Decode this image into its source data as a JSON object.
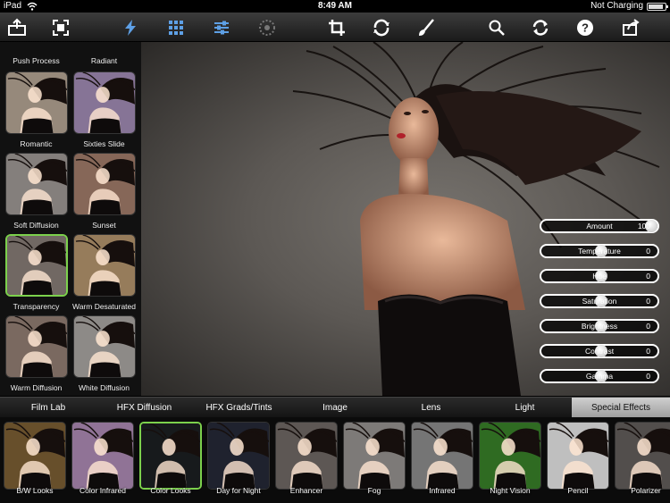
{
  "status": {
    "device": "iPad",
    "time": "8:49 AM",
    "charging": "Not Charging"
  },
  "toolbar": {
    "icons": [
      "import-icon",
      "fit-screen-icon",
      "presets-lightning-icon",
      "grid-icon",
      "adjust-sliders-icon",
      "mask-icon",
      "crop-icon",
      "rotate-icon",
      "brush-icon",
      "zoom-icon",
      "refresh-icon",
      "help-icon",
      "share-icon"
    ],
    "accent": "#5ea0e6"
  },
  "sidebar": {
    "top_labels": [
      "Push Process",
      "Radiant"
    ],
    "presets": [
      {
        "label": "Romantic",
        "tint": "#c9b7a4"
      },
      {
        "label": "Sixties Slide",
        "tint": "#b39bc8"
      },
      {
        "label": "Soft Diffusion",
        "tint": "#b0aaa6"
      },
      {
        "label": "Sunset",
        "tint": "#b38a76"
      },
      {
        "label": "Transparency",
        "tint": "#978b85"
      },
      {
        "label": "Warm Desaturated",
        "tint": "#c9a67a"
      },
      {
        "label": "Warm Diffusion",
        "tint": "#a38d80"
      },
      {
        "label": "White Diffusion",
        "tint": "#bdb8b4"
      }
    ],
    "selected_index": 4,
    "selected_color": "#7cd14c"
  },
  "sliders": [
    {
      "label": "Amount",
      "value": "100",
      "level": 1.0
    },
    {
      "label": "Temperature",
      "value": "0",
      "level": 0.5
    },
    {
      "label": "Hue",
      "value": "0",
      "level": 0.5
    },
    {
      "label": "Saturation",
      "value": "0",
      "level": 0.5
    },
    {
      "label": "Brightness",
      "value": "0",
      "level": 0.5
    },
    {
      "label": "Contrast",
      "value": "0",
      "level": 0.5
    },
    {
      "label": "Gamma",
      "value": "0",
      "level": 0.5
    }
  ],
  "tabs": [
    "Film Lab",
    "HFX Diffusion",
    "HFX Grads/Tints",
    "Image",
    "Lens",
    "Light",
    "Special Effects"
  ],
  "active_tab": 6,
  "filters": [
    {
      "label": "B/W Looks",
      "tint": "#8a6a3a"
    },
    {
      "label": "Color Infrared",
      "tint": "#c09ac8"
    },
    {
      "label": "Color Looks",
      "tint": "#1f2326"
    },
    {
      "label": "Day for Night",
      "tint": "#2a2e3e"
    },
    {
      "label": "Enhancer",
      "tint": "#7d7571"
    },
    {
      "label": "Fog",
      "tint": "#a7a3a0"
    },
    {
      "label": "Infrared",
      "tint": "#9c9c9c"
    },
    {
      "label": "Night Vision",
      "tint": "#3f8f2e"
    },
    {
      "label": "Pencil",
      "tint": "#ffffff"
    },
    {
      "label": "Polarizer",
      "tint": "#6e6966"
    }
  ],
  "selected_filter": 2
}
